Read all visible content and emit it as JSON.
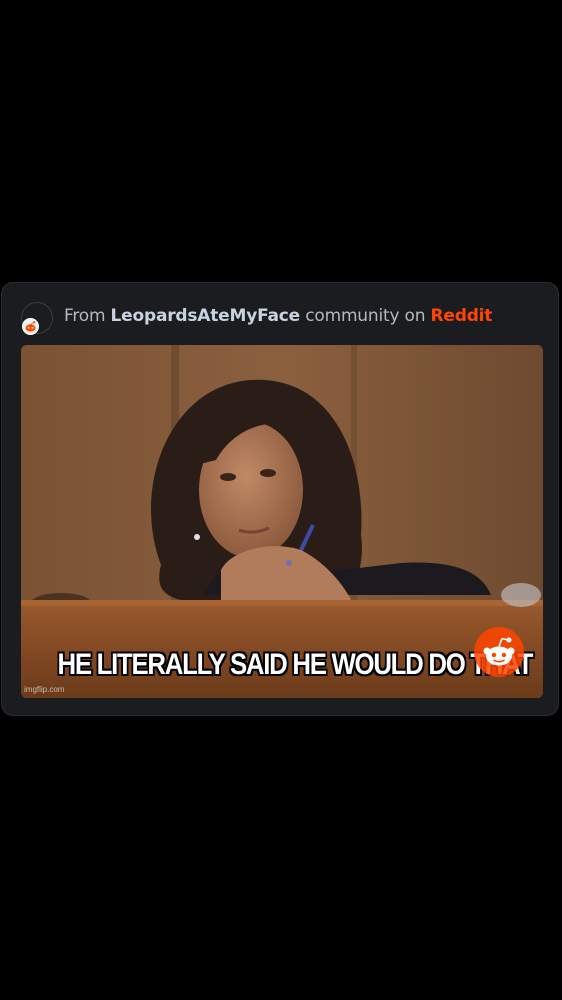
{
  "source": {
    "prefix": "From",
    "community": "LeopardsAteMyFace",
    "middle": "community on",
    "platform": "Reddit",
    "avatar_icon": "reddit-community-avatar-icon"
  },
  "meme": {
    "caption": "HE LITERALLY SAID HE WOULD DO THAT",
    "watermark": "imgflip.com",
    "badge_icon": "reddit-snoo-icon"
  },
  "colors": {
    "background": "#000000",
    "card": "#1b1c1f",
    "platform_accent": "#ff4500",
    "community_text": "#c9d1e2",
    "muted_text": "#b5b8bf"
  }
}
